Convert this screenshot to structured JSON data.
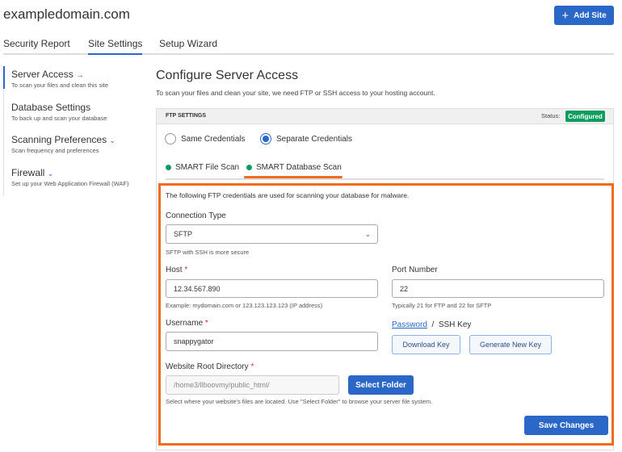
{
  "header": {
    "title": "exampledomain.com",
    "add_site": "Add Site"
  },
  "tabs": [
    {
      "label": "Security Report"
    },
    {
      "label": "Site Settings"
    },
    {
      "label": "Setup Wizard"
    }
  ],
  "sidebar": {
    "items": [
      {
        "label": "Server Access",
        "sub": "To scan your files and clean this site"
      },
      {
        "label": "Database Settings",
        "sub": "To back up and scan your database"
      },
      {
        "label": "Scanning Preferences",
        "sub": "Scan frequency and preferences"
      },
      {
        "label": "Firewall",
        "sub": "Set up your Web Application Firewall (WAF)"
      }
    ]
  },
  "main": {
    "title": "Configure Server Access",
    "description": "To scan your files and clean your site, we need FTP or SSH access to your hosting account.",
    "panel": {
      "header": "FTP SETTINGS",
      "status_label": "Status:",
      "status": "Configured",
      "status_color": "#0b9d5f",
      "radios": [
        {
          "label": "Same Credentials",
          "checked": false
        },
        {
          "label": "Separate Credentials",
          "checked": true
        }
      ],
      "scan_tabs": [
        {
          "label": "SMART File Scan"
        },
        {
          "label": "SMART Database Scan"
        }
      ],
      "intro": "The following FTP credentials are used for scanning your database for malware.",
      "connection_type": {
        "label": "Connection Type",
        "value": "SFTP",
        "help": "SFTP with SSH is more secure"
      },
      "host": {
        "label": "Host",
        "value": "12.34.567.890",
        "help": "Example: mydomain.com or 123.123.123.123 (IP address)"
      },
      "port": {
        "label": "Port Number",
        "value": "22",
        "help": "Typically 21 for FTP and 22 for SFTP"
      },
      "username": {
        "label": "Username",
        "value": "snappygator"
      },
      "auth": {
        "password": "Password",
        "sep": "/",
        "ssh_key": "SSH Key",
        "download": "Download Key",
        "generate": "Generate New Key"
      },
      "root_dir": {
        "label": "Website Root Directory",
        "value": "/home3/llboovmy/public_html/",
        "button": "Select Folder",
        "help": "Select where your website's files are located. Use \"Select Folder\" to browse your server file system."
      },
      "save": "Save Changes",
      "required": "*"
    }
  }
}
